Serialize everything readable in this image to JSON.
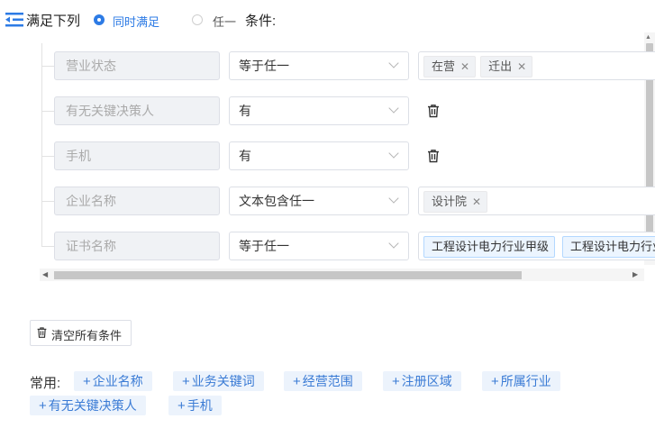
{
  "header": {
    "title": "满足下列",
    "radio_all": "同时满足",
    "radio_any": "任一",
    "condition_label": "条件:"
  },
  "rows": [
    {
      "field": "营业状态",
      "operator": "等于任一",
      "tags": [
        "在营",
        "迁出"
      ]
    },
    {
      "field": "有无关键决策人",
      "operator": "有"
    },
    {
      "field": "手机",
      "operator": "有"
    },
    {
      "field": "企业名称",
      "operator": "文本包含任一",
      "tags": [
        "设计院"
      ]
    },
    {
      "field": "证书名称",
      "operator": "等于任一",
      "tags": [
        "工程设计电力行业甲级",
        "工程设计电力行业"
      ]
    }
  ],
  "clear_button": "清空所有条件",
  "common": {
    "label": "常用:",
    "items": [
      "企业名称",
      "业务关键词",
      "经营范围",
      "注册区域",
      "所属行业",
      "有无关键决策人",
      "手机"
    ]
  },
  "colors": {
    "accent": "#2d7be5",
    "chip_bg": "#ecf3fc"
  }
}
